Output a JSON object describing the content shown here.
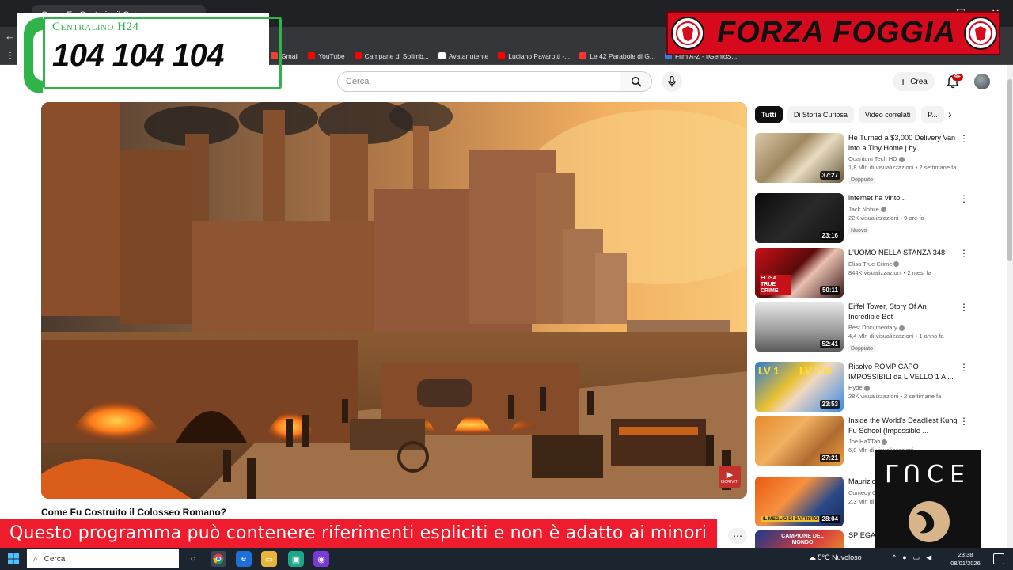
{
  "browser": {
    "tab_title": "Come Fu Costruito il Colosseo...",
    "bookmarks": [
      {
        "label": "Gmail",
        "color": "#ea4335"
      },
      {
        "label": "YouTube",
        "color": "#ff0000"
      },
      {
        "label": "Campane di Solimb...",
        "color": "#ff0000"
      },
      {
        "label": "Avatar utente",
        "color": "#ffffff"
      },
      {
        "label": "Luciano Pavarotti -...",
        "color": "#ff0000"
      },
      {
        "label": "Le 42 Parabole di G...",
        "color": "#ff3333"
      },
      {
        "label": "Film A-Z - ilGenioS...",
        "color": "#3b7bd6"
      }
    ]
  },
  "youtube": {
    "search_placeholder": "Cerca",
    "create_label": "Crea",
    "notif_badge": "9+",
    "video_title": "Come Fu Costruito il Colosseo Romano?",
    "watermark_label": "ISCRIVITI",
    "chips": [
      "Tutti",
      "Di Storia Curiosa",
      "Video correlati",
      "P..."
    ],
    "recommendations": [
      {
        "title": "He Turned a $3,000 Delivery Van into a Tiny Home | by ...",
        "channel": "Quantum Tech HD",
        "meta": "1,8 Mln di visualizzazioni • 2 settimane fa",
        "duration": "37:27",
        "tag": "Doppiato",
        "verified": true
      },
      {
        "title": "internet ha vinto...",
        "channel": "Jack Nobile",
        "meta": "22K visualizzazioni • 9 ore fa",
        "duration": "23:16",
        "tag": "Nuovo",
        "verified": true
      },
      {
        "title": "L'UOMO NELLA STANZA 348",
        "channel": "Elisa True Crime",
        "meta": "844K visualizzazioni • 2 mesi fa",
        "duration": "50:11",
        "tag": "",
        "verified": true
      },
      {
        "title": "Eiffel Tower, Story Of An Incredible Bet",
        "channel": "Best Documentary",
        "meta": "4,4 Mln di visualizzazioni • 1 anno fa",
        "duration": "52:41",
        "tag": "Doppiato",
        "verified": true
      },
      {
        "title": "Risolvo ROMPICAPO IMPOSSIBILI da LIVELLO 1 A ...",
        "channel": "Hyde",
        "meta": "28K visualizzazioni • 2 settimane fa",
        "duration": "23:53",
        "tag": "",
        "verified": true
      },
      {
        "title": "Inside the World's Deadliest Kung Fu School (Impossible ...",
        "channel": "Joe HaTTab",
        "meta": "6,8 Mln di visualizzazioni",
        "duration": "27:21",
        "tag": "",
        "verified": true
      },
      {
        "title": "Maurizio Battisto...",
        "channel": "Comedy C...",
        "meta": "2,3 Mln di ...",
        "duration": "28:04",
        "tag": "",
        "verified": false
      },
      {
        "title": "SPIEGA... MAGIE ...",
        "channel": "",
        "meta": "",
        "duration": "",
        "tag": "",
        "verified": false
      }
    ],
    "thumb_texts": {
      "elisa": "ELISA TRUE CRIME",
      "lv1": "LV 1",
      "lv100": "LV 100",
      "battisto": "IL MEGLIO DI BATTISTO",
      "campione": "CAMPIONE DEL MONDO"
    }
  },
  "overlays": {
    "phone_label": "Centralino H24",
    "phone_number": "104 104 104",
    "banner_text": "FORZA FOGGIA",
    "disclaimer": "Questo programma  può contenere riferimenti espliciti e non è adatto ai minori",
    "logo_word": "LUCE"
  },
  "taskbar": {
    "search_label": "Cerca",
    "weather": "5°C  Nuvoloso",
    "time": "23:38",
    "date": "08/01/2026"
  },
  "colors": {
    "yt_red": "#ff0000",
    "disclaimer_red": "#ee1c2c",
    "phone_green": "#2fb34a",
    "forza_red": "#d60a1c"
  }
}
